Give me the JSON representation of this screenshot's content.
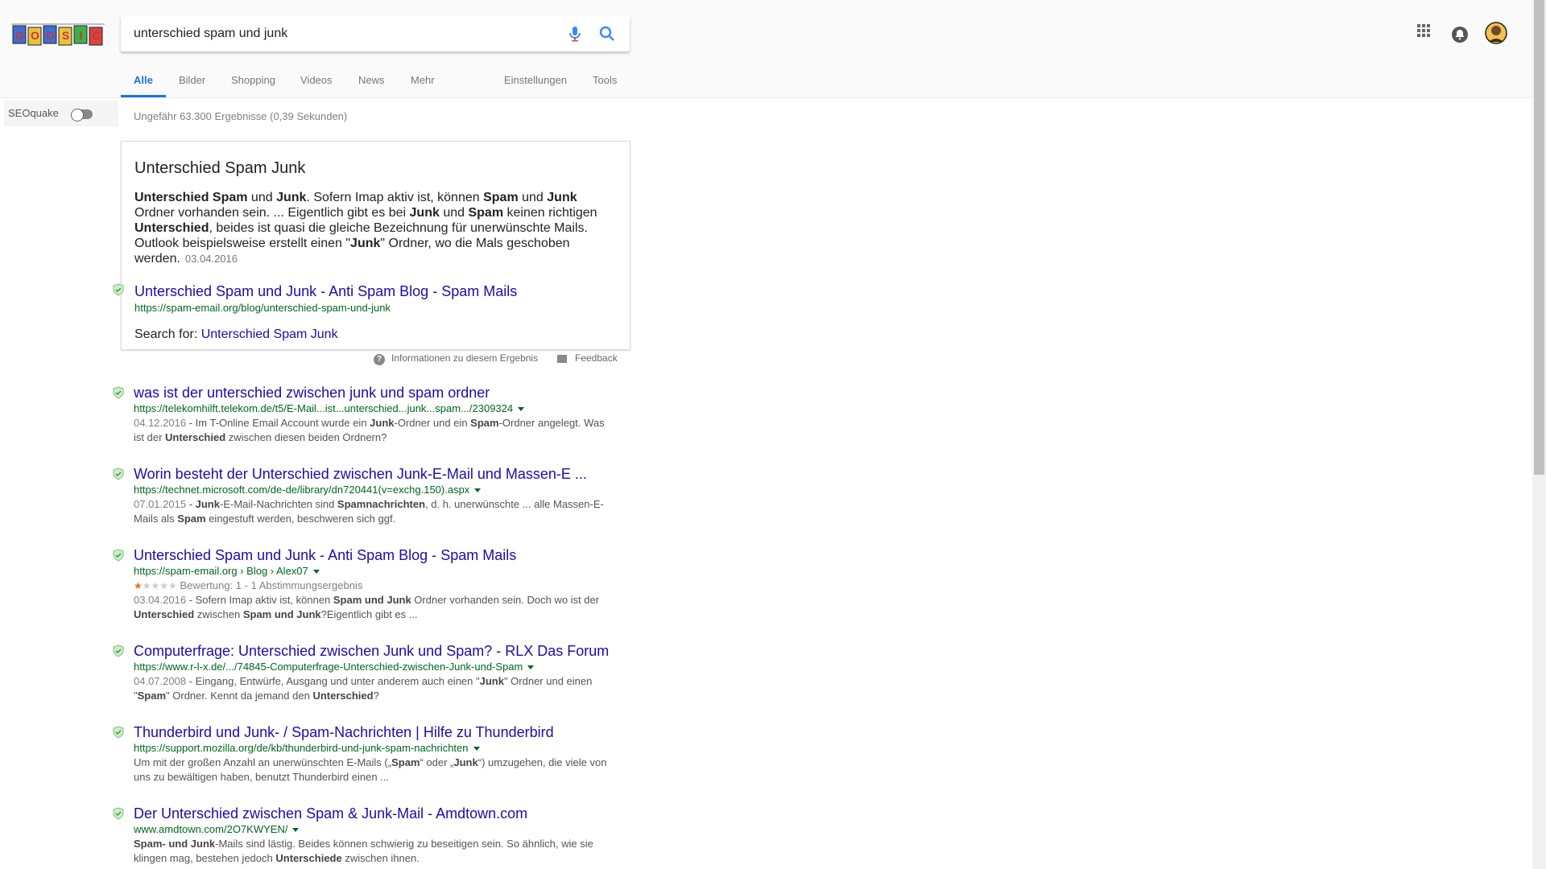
{
  "search": {
    "query": "unterschied spam und junk"
  },
  "logo": {
    "letters": [
      "G",
      "O",
      "O",
      "S",
      "I",
      "C"
    ]
  },
  "tabs": [
    {
      "label": "Alle"
    },
    {
      "label": "Bilder"
    },
    {
      "label": "Shopping"
    },
    {
      "label": "Videos"
    },
    {
      "label": "News"
    },
    {
      "label": "Mehr"
    },
    {
      "label": "Einstellungen"
    },
    {
      "label": "Tools"
    }
  ],
  "seoquake": {
    "label": "SEOquake"
  },
  "stats": "Ungefähr 63.300 Ergebnisse (0,39 Sekunden)",
  "snippet": {
    "title": "Unterschied Spam Junk",
    "date": "03.04.2016",
    "link_title": "Unterschied Spam und Junk - Anti Spam Blog - Spam Mails",
    "url": "https://spam-email.org/blog/unterschied-spam-und-junk",
    "search_for_label": "Search for: ",
    "search_for_link": "Unterschied Spam Junk",
    "info_label": "Informationen zu diesem Ergebnis",
    "feedback_label": "Feedback"
  },
  "results": [
    {
      "title": "was ist der unterschied zwischen junk und spam ordner",
      "url": "https://telekomhilft.telekom.de/t5/E-Mail...ist...unterschied...junk...spam.../2309324",
      "date": "04.12.2016"
    },
    {
      "title": "Worin besteht der Unterschied zwischen Junk-E-Mail und Massen-E ...",
      "url": "https://technet.microsoft.com/de-de/library/dn720441(v=exchg.150).aspx",
      "date": "07.01.2015"
    },
    {
      "title": "Unterschied Spam und Junk - Anti Spam Blog - Spam Mails",
      "url": "https://spam-email.org › Blog › Alex07",
      "rating": "Bewertung: 1 - 1 Abstimmungsergebnis",
      "rating_stars": 1,
      "date": "03.04.2016"
    },
    {
      "title": "Computerfrage: Unterschied zwischen Junk und Spam? - RLX Das Forum",
      "url": "https://www.r-l-x.de/.../74845-Computerfrage-Unterschied-zwischen-Junk-und-Spam",
      "date": "04.07.2008"
    },
    {
      "title": "Thunderbird und Junk- / Spam-Nachrichten | Hilfe zu Thunderbird",
      "url": "https://support.mozilla.org/de/kb/thunderbird-und-junk-spam-nachrichten"
    },
    {
      "title": "Der Unterschied zwischen Spam & Junk-Mail - Amdtown.com",
      "url": "www.amdtown.com/2O7KWYEN/"
    }
  ],
  "colors": {
    "link": "#1a0dab",
    "url": "#006621",
    "accent": "#1a73e8"
  }
}
